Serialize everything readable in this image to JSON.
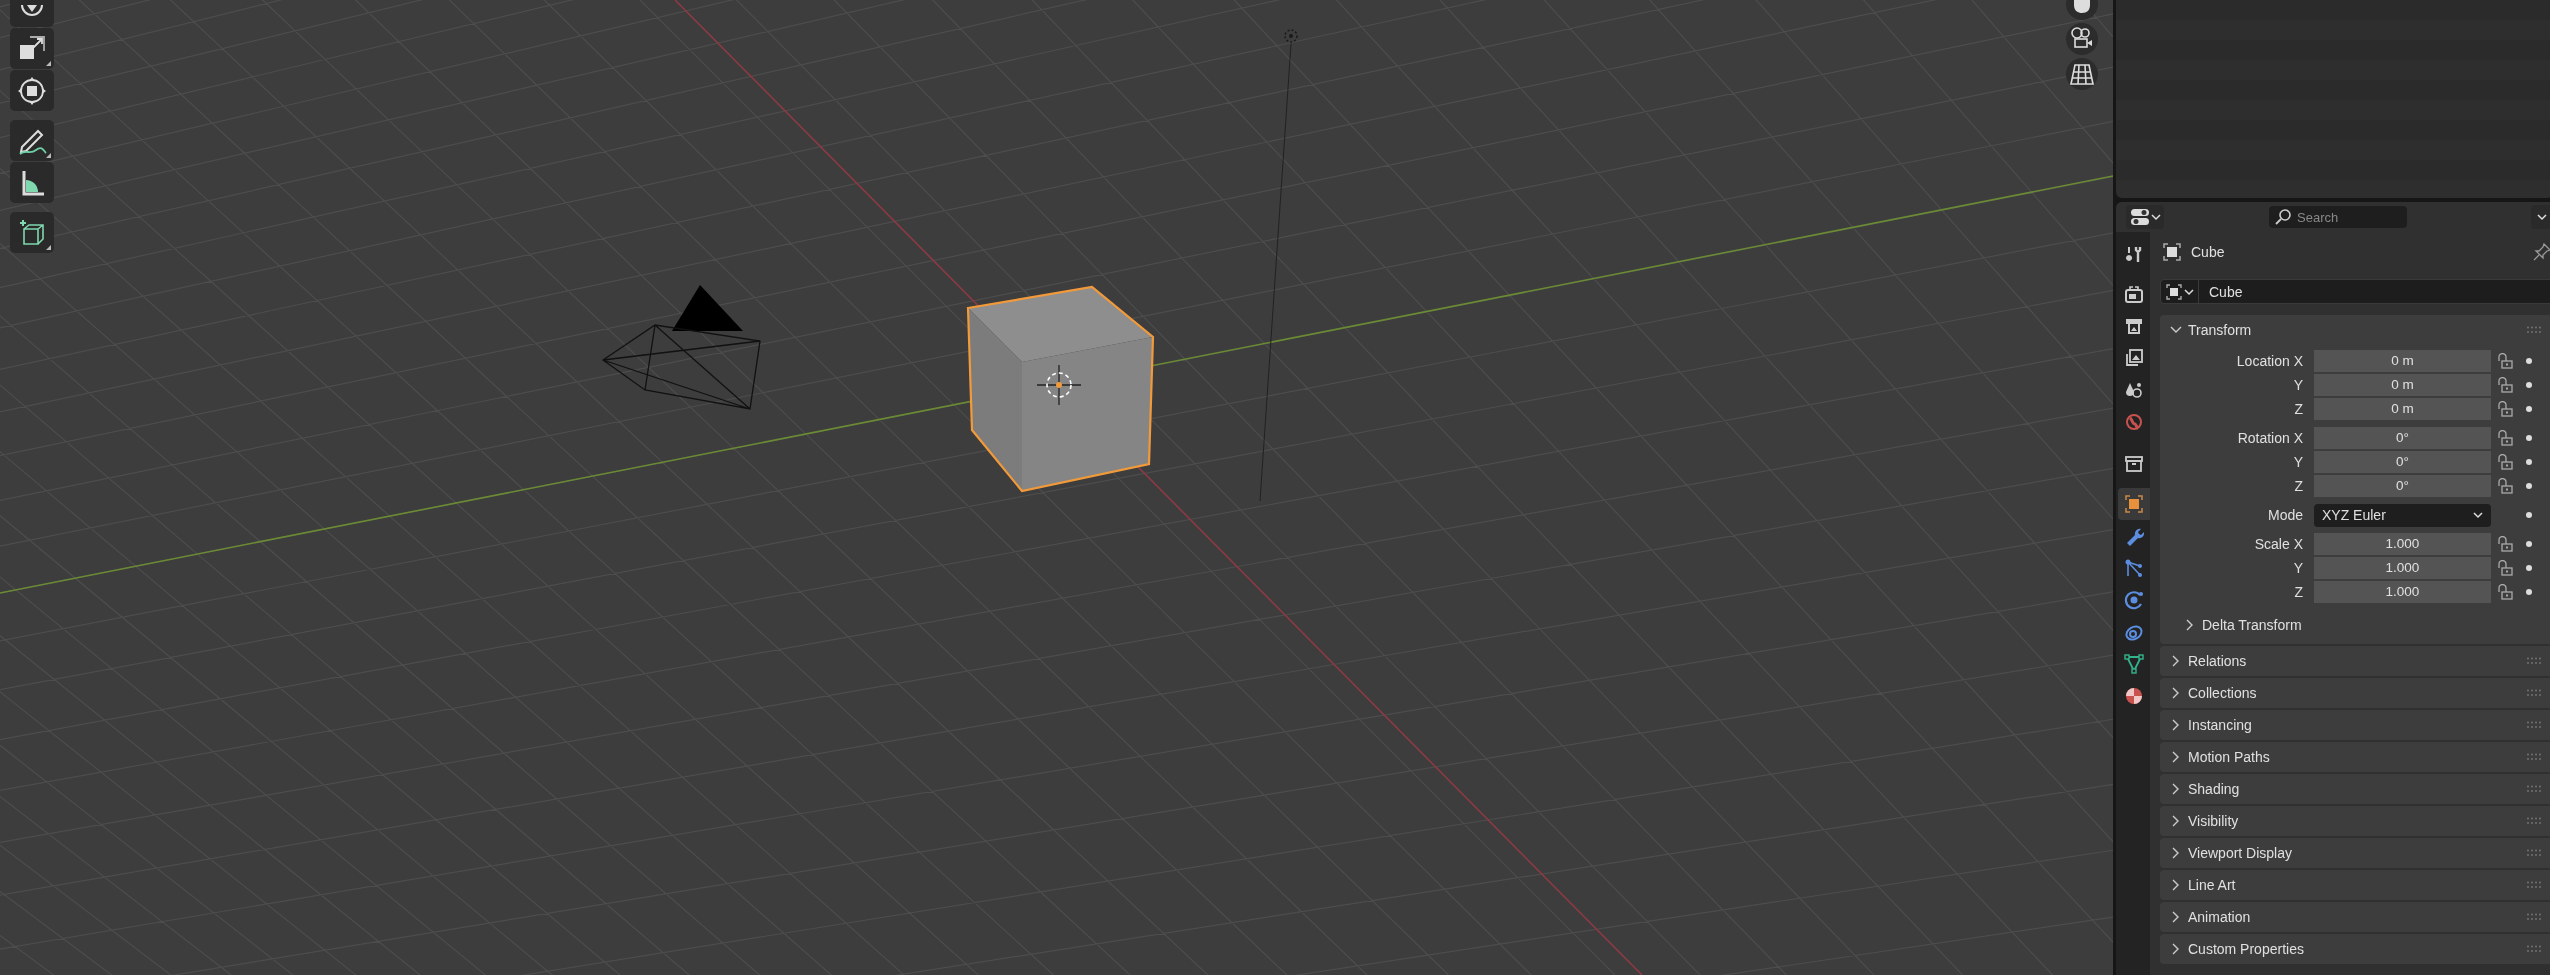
{
  "viewport": {
    "tools": [
      {
        "kind": "rotate"
      },
      {
        "kind": "scale"
      },
      {
        "kind": "transform"
      },
      {
        "kind": "annotate"
      },
      {
        "kind": "measure"
      },
      {
        "kind": "add_cube"
      }
    ],
    "nav_buttons": [
      {
        "kind": "hand"
      },
      {
        "kind": "camera"
      },
      {
        "kind": "grid"
      }
    ]
  },
  "properties_editor": {
    "search": {
      "placeholder": "Search"
    },
    "tabs": [
      {
        "kind": "tool",
        "selected": false
      },
      {
        "kind": "render",
        "selected": false
      },
      {
        "kind": "output",
        "selected": false
      },
      {
        "kind": "view_layer",
        "selected": false
      },
      {
        "kind": "scene",
        "selected": false
      },
      {
        "kind": "world",
        "selected": false
      },
      {
        "kind": "collection",
        "selected": false
      },
      {
        "kind": "object",
        "selected": true
      },
      {
        "kind": "modifiers",
        "selected": false
      },
      {
        "kind": "particles",
        "selected": false
      },
      {
        "kind": "physics",
        "selected": false
      },
      {
        "kind": "constraints",
        "selected": false
      },
      {
        "kind": "data",
        "selected": false
      },
      {
        "kind": "material",
        "selected": false
      }
    ],
    "context": {
      "object_name": "Cube"
    },
    "object_field": {
      "value": "Cube"
    },
    "transform": {
      "title": "Transform",
      "expanded": true,
      "groups": [
        {
          "rows": [
            {
              "kind": "number",
              "label": "Location X",
              "value": "0 m",
              "locked": false
            },
            {
              "kind": "number",
              "label": "Y",
              "value": "0 m",
              "locked": false
            },
            {
              "kind": "number",
              "label": "Z",
              "value": "0 m",
              "locked": false
            }
          ]
        },
        {
          "rows": [
            {
              "kind": "number",
              "label": "Rotation X",
              "value": "0°",
              "locked": false
            },
            {
              "kind": "number",
              "label": "Y",
              "value": "0°",
              "locked": false
            },
            {
              "kind": "number",
              "label": "Z",
              "value": "0°",
              "locked": false
            }
          ]
        },
        {
          "rows": [
            {
              "kind": "dropdown",
              "label": "Mode",
              "value": "XYZ Euler"
            }
          ]
        },
        {
          "rows": [
            {
              "kind": "number",
              "label": "Scale X",
              "value": "1.000",
              "locked": false
            },
            {
              "kind": "number",
              "label": "Y",
              "value": "1.000",
              "locked": false
            },
            {
              "kind": "number",
              "label": "Z",
              "value": "1.000",
              "locked": false
            }
          ]
        }
      ],
      "subpanel": {
        "title": "Delta Transform",
        "expanded": false
      }
    },
    "panels": [
      {
        "title": "Relations",
        "expanded": false
      },
      {
        "title": "Collections",
        "expanded": false
      },
      {
        "title": "Instancing",
        "expanded": false
      },
      {
        "title": "Motion Paths",
        "expanded": false
      },
      {
        "title": "Shading",
        "expanded": false
      },
      {
        "title": "Visibility",
        "expanded": false
      },
      {
        "title": "Viewport Display",
        "expanded": false
      },
      {
        "title": "Line Art",
        "expanded": false
      },
      {
        "title": "Animation",
        "expanded": false
      },
      {
        "title": "Custom Properties",
        "expanded": false
      }
    ]
  }
}
